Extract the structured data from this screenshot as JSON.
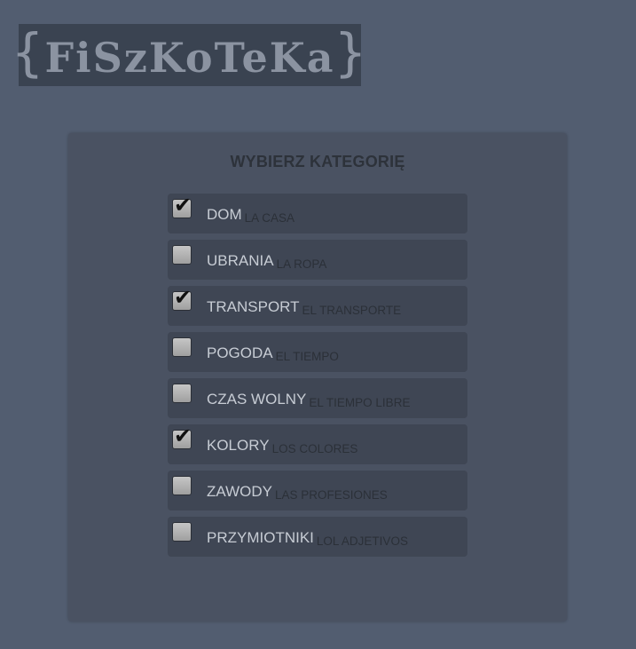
{
  "header": {
    "logo_brace_left": "{",
    "logo_name": "FiSzKoTeKa",
    "logo_brace_right": "}"
  },
  "panel": {
    "title": "WYBIERZ KATEGORIĘ"
  },
  "categories": [
    {
      "pl": "DOM",
      "es": "LA CASA",
      "checked": true
    },
    {
      "pl": "UBRANIA",
      "es": "LA ROPA",
      "checked": false
    },
    {
      "pl": "TRANSPORT",
      "es": "EL TRANSPORTE",
      "checked": true
    },
    {
      "pl": "POGODA",
      "es": "EL TIEMPO",
      "checked": false
    },
    {
      "pl": "CZAS WOLNY",
      "es": "EL TIEMPO LIBRE",
      "checked": false
    },
    {
      "pl": "KOLORY",
      "es": "LOS COLORES",
      "checked": true
    },
    {
      "pl": "ZAWODY",
      "es": "LAS PROFESIONES",
      "checked": false
    },
    {
      "pl": "PRZYMIOTNIKI",
      "es": "LOL ADJETIVOS",
      "checked": false
    }
  ],
  "checkmark_glyph": "✔",
  "colors": {
    "page_background": "#525d70",
    "panel_background": "#4a5262",
    "item_background": "#3f4654",
    "logo_background": "#3a4351"
  }
}
